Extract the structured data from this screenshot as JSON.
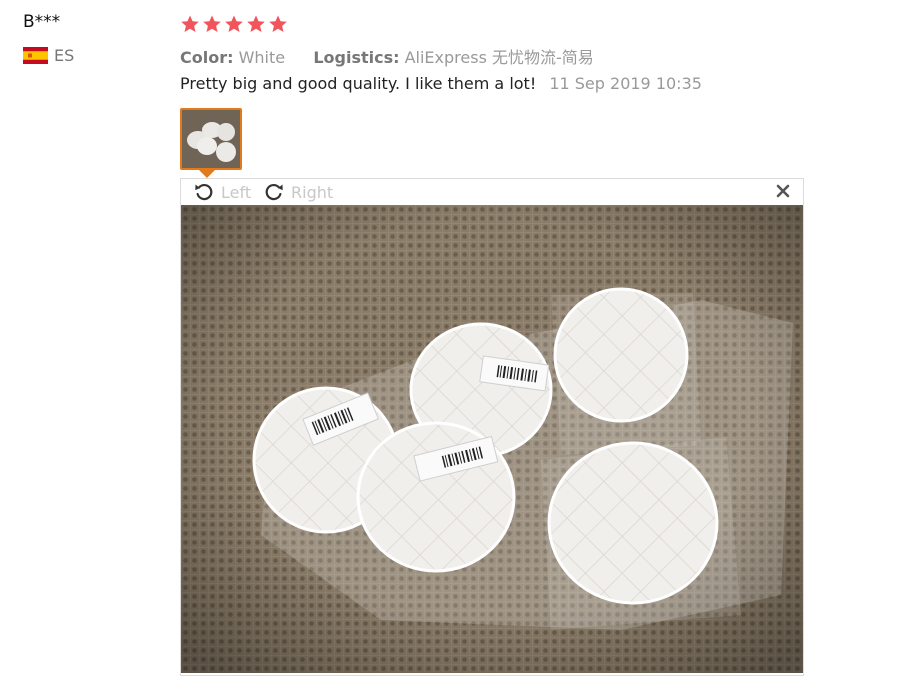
{
  "reviewer": {
    "name": "B***",
    "country_code": "ES",
    "flag_icon": "spain-flag-icon"
  },
  "rating": {
    "stars": 5,
    "max": 5,
    "color": "#f2545b"
  },
  "attributes": {
    "color_label": "Color:",
    "color_value": "White",
    "logistics_label": "Logistics:",
    "logistics_value": "AliExpress 无忧物流-简易"
  },
  "review": {
    "text": "Pretty big and good quality. I like them a lot!",
    "date": "11 Sep 2019 10:35"
  },
  "viewer": {
    "rotate_left_label": "Left",
    "rotate_right_label": "Right",
    "rotate_left_icon": "rotate-left-icon",
    "rotate_right_icon": "rotate-right-icon",
    "close_icon": "close-icon",
    "accent_color": "#e07a1a"
  }
}
